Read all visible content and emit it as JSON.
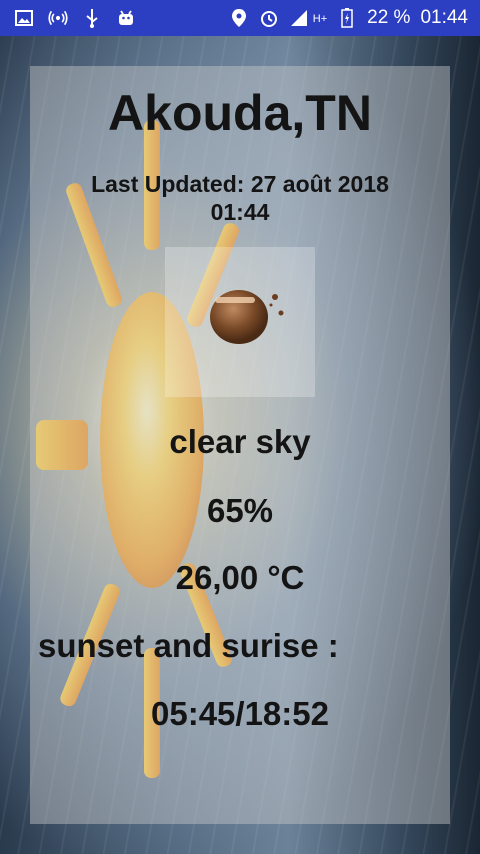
{
  "status_bar": {
    "battery_percent": "22 %",
    "time": "01:44",
    "network": "H+",
    "icons": [
      "image-icon",
      "wifi-hotspot-icon",
      "usb-icon",
      "android-icon",
      "location-icon",
      "alarm-icon",
      "signal-icon",
      "battery-icon"
    ]
  },
  "weather": {
    "city": "Akouda,TN",
    "last_updated": "Last Updated: 27 août 2018 01:44",
    "description": "clear sky",
    "humidity": "65%",
    "temperature": "26,00 °C",
    "sun_label": "sunset and surise :",
    "sun_times": "05:45/18:52",
    "icon": "clear-night-moon-icon"
  },
  "colors": {
    "status_bar": "#2c3ec2",
    "text": "#141414",
    "sun": "#f5a623"
  }
}
